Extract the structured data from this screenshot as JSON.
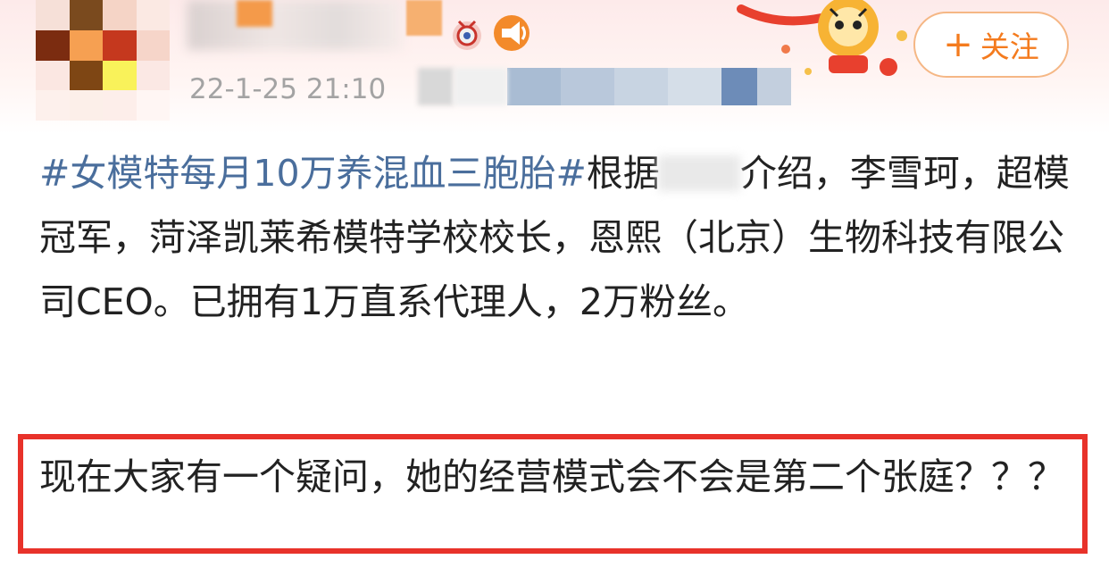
{
  "post": {
    "timestamp": "22-1-25 21:10",
    "body": {
      "hashtag": "#女模特每月10万养混血三胞胎#",
      "text_before_redaction": "根据",
      "text_after_redaction": "介绍，李雪珂，超模冠军，菏泽凯莱希模特学校校长，恩熙（北京）生物科技有限公司CEO。已拥有1万直系代理人，2万粉丝。"
    },
    "highlighted_question": "现在大家有一个疑问，她的经营模式会不会是第二个张庭？？？"
  },
  "follow_button": {
    "plus": "+",
    "label": "关注"
  },
  "colors": {
    "hashtag": "#4a6e9c",
    "follow_accent": "#f47b1e",
    "highlight_border": "#e8322a",
    "timestamp": "#a3a3a3"
  },
  "icons": [
    "avatar-image",
    "weibo-badge-icon",
    "megaphone-icon",
    "tiger-mascot-decoration"
  ]
}
